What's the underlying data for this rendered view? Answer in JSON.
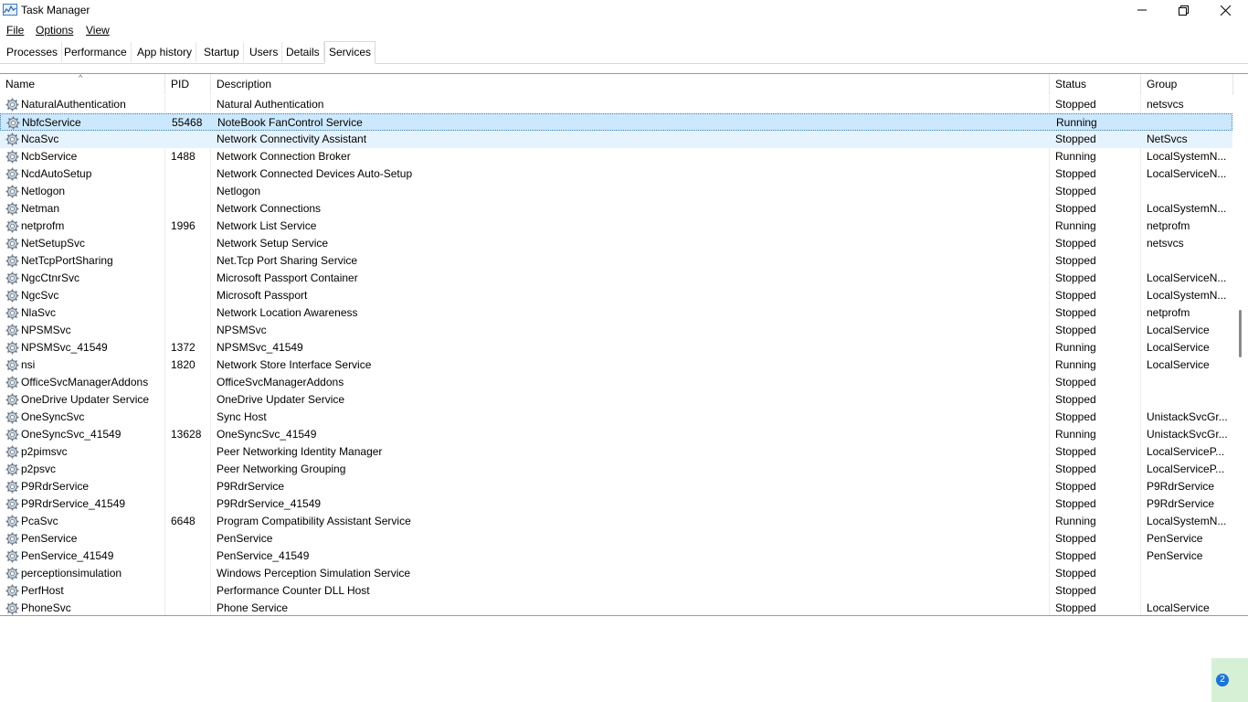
{
  "window": {
    "title": "Task Manager",
    "minimize": "─",
    "restore": "❐",
    "close": "✕"
  },
  "menu": {
    "file": "File",
    "options": "Options",
    "view": "View"
  },
  "tabs": [
    "Processes",
    "Performance",
    "App history",
    "Startup",
    "Users",
    "Details",
    "Services"
  ],
  "active_tab": "Services",
  "columns": [
    "Name",
    "PID",
    "Description",
    "Status",
    "Group"
  ],
  "sort_indicator": "^",
  "services": [
    {
      "name": "NaturalAuthentication",
      "pid": "",
      "description": "Natural Authentication",
      "status": "Stopped",
      "group": "netsvcs"
    },
    {
      "name": "NbfcService",
      "pid": "55468",
      "description": "NoteBook FanControl Service",
      "status": "Running",
      "group": ""
    },
    {
      "name": "NcaSvc",
      "pid": "",
      "description": "Network Connectivity Assistant",
      "status": "Stopped",
      "group": "NetSvcs"
    },
    {
      "name": "NcbService",
      "pid": "1488",
      "description": "Network Connection Broker",
      "status": "Running",
      "group": "LocalSystemN..."
    },
    {
      "name": "NcdAutoSetup",
      "pid": "",
      "description": "Network Connected Devices Auto-Setup",
      "status": "Stopped",
      "group": "LocalServiceN..."
    },
    {
      "name": "Netlogon",
      "pid": "",
      "description": "Netlogon",
      "status": "Stopped",
      "group": ""
    },
    {
      "name": "Netman",
      "pid": "",
      "description": "Network Connections",
      "status": "Stopped",
      "group": "LocalSystemN..."
    },
    {
      "name": "netprofm",
      "pid": "1996",
      "description": "Network List Service",
      "status": "Running",
      "group": "netprofm"
    },
    {
      "name": "NetSetupSvc",
      "pid": "",
      "description": "Network Setup Service",
      "status": "Stopped",
      "group": "netsvcs"
    },
    {
      "name": "NetTcpPortSharing",
      "pid": "",
      "description": "Net.Tcp Port Sharing Service",
      "status": "Stopped",
      "group": ""
    },
    {
      "name": "NgcCtnrSvc",
      "pid": "",
      "description": "Microsoft Passport Container",
      "status": "Stopped",
      "group": "LocalServiceN..."
    },
    {
      "name": "NgcSvc",
      "pid": "",
      "description": "Microsoft Passport",
      "status": "Stopped",
      "group": "LocalSystemN..."
    },
    {
      "name": "NlaSvc",
      "pid": "",
      "description": "Network Location Awareness",
      "status": "Stopped",
      "group": "netprofm"
    },
    {
      "name": "NPSMSvc",
      "pid": "",
      "description": "NPSMSvc",
      "status": "Stopped",
      "group": "LocalService"
    },
    {
      "name": "NPSMSvc_41549",
      "pid": "1372",
      "description": "NPSMSvc_41549",
      "status": "Running",
      "group": "LocalService"
    },
    {
      "name": "nsi",
      "pid": "1820",
      "description": "Network Store Interface Service",
      "status": "Running",
      "group": "LocalService"
    },
    {
      "name": "OfficeSvcManagerAddons",
      "pid": "",
      "description": "OfficeSvcManagerAddons",
      "status": "Stopped",
      "group": ""
    },
    {
      "name": "OneDrive Updater Service",
      "pid": "",
      "description": "OneDrive Updater Service",
      "status": "Stopped",
      "group": ""
    },
    {
      "name": "OneSyncSvc",
      "pid": "",
      "description": "Sync Host",
      "status": "Stopped",
      "group": "UnistackSvcGr..."
    },
    {
      "name": "OneSyncSvc_41549",
      "pid": "13628",
      "description": "OneSyncSvc_41549",
      "status": "Running",
      "group": "UnistackSvcGr..."
    },
    {
      "name": "p2pimsvc",
      "pid": "",
      "description": "Peer Networking Identity Manager",
      "status": "Stopped",
      "group": "LocalServiceP..."
    },
    {
      "name": "p2psvc",
      "pid": "",
      "description": "Peer Networking Grouping",
      "status": "Stopped",
      "group": "LocalServiceP..."
    },
    {
      "name": "P9RdrService",
      "pid": "",
      "description": "P9RdrService",
      "status": "Stopped",
      "group": "P9RdrService"
    },
    {
      "name": "P9RdrService_41549",
      "pid": "",
      "description": "P9RdrService_41549",
      "status": "Stopped",
      "group": "P9RdrService"
    },
    {
      "name": "PcaSvc",
      "pid": "6648",
      "description": "Program Compatibility Assistant Service",
      "status": "Running",
      "group": "LocalSystemN..."
    },
    {
      "name": "PenService",
      "pid": "",
      "description": "PenService",
      "status": "Stopped",
      "group": "PenService"
    },
    {
      "name": "PenService_41549",
      "pid": "",
      "description": "PenService_41549",
      "status": "Stopped",
      "group": "PenService"
    },
    {
      "name": "perceptionsimulation",
      "pid": "",
      "description": "Windows Perception Simulation Service",
      "status": "Stopped",
      "group": ""
    },
    {
      "name": "PerfHost",
      "pid": "",
      "description": "Performance Counter DLL Host",
      "status": "Stopped",
      "group": ""
    },
    {
      "name": "PhoneSvc",
      "pid": "",
      "description": "Phone Service",
      "status": "Stopped",
      "group": "LocalService"
    }
  ],
  "selected_service": "NbfcService",
  "hovered_service": "NcaSvc",
  "notification_badge": "2",
  "colors": {
    "selection": "#cce8ff",
    "hover": "#e5f3ff",
    "badge": "#1a73d9"
  }
}
